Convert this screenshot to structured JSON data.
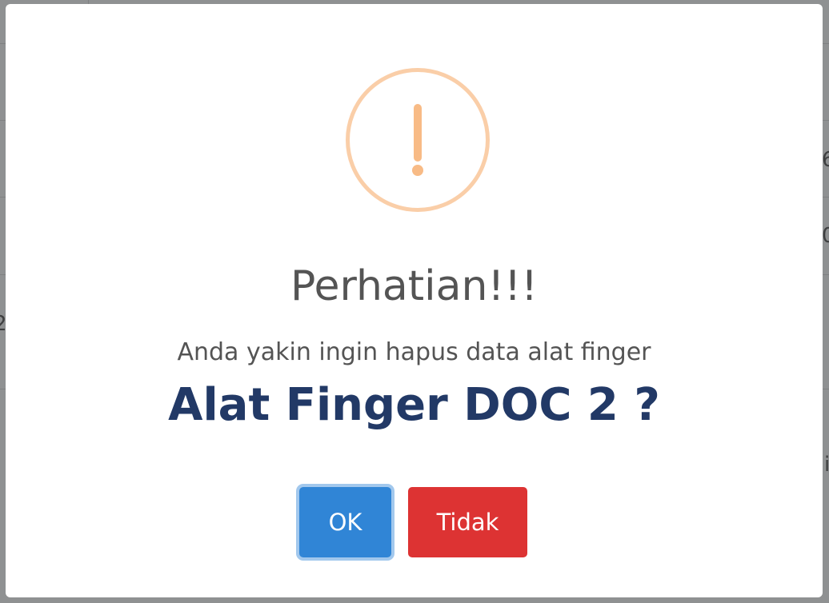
{
  "background": {
    "peek_texts": [
      "6",
      "0",
      "2",
      "i"
    ]
  },
  "dialog": {
    "icon": "warning-exclamation-icon",
    "title": "Perhatian!!!",
    "message": "Anda yakin ingin hapus data alat finger",
    "device_name": "Alat Finger DOC 2 ?",
    "confirm_label": "OK",
    "cancel_label": "Tidak"
  },
  "colors": {
    "confirm": "#3085d6",
    "cancel": "#dd3333",
    "icon": "#f8bb86",
    "device_name": "#223966"
  }
}
